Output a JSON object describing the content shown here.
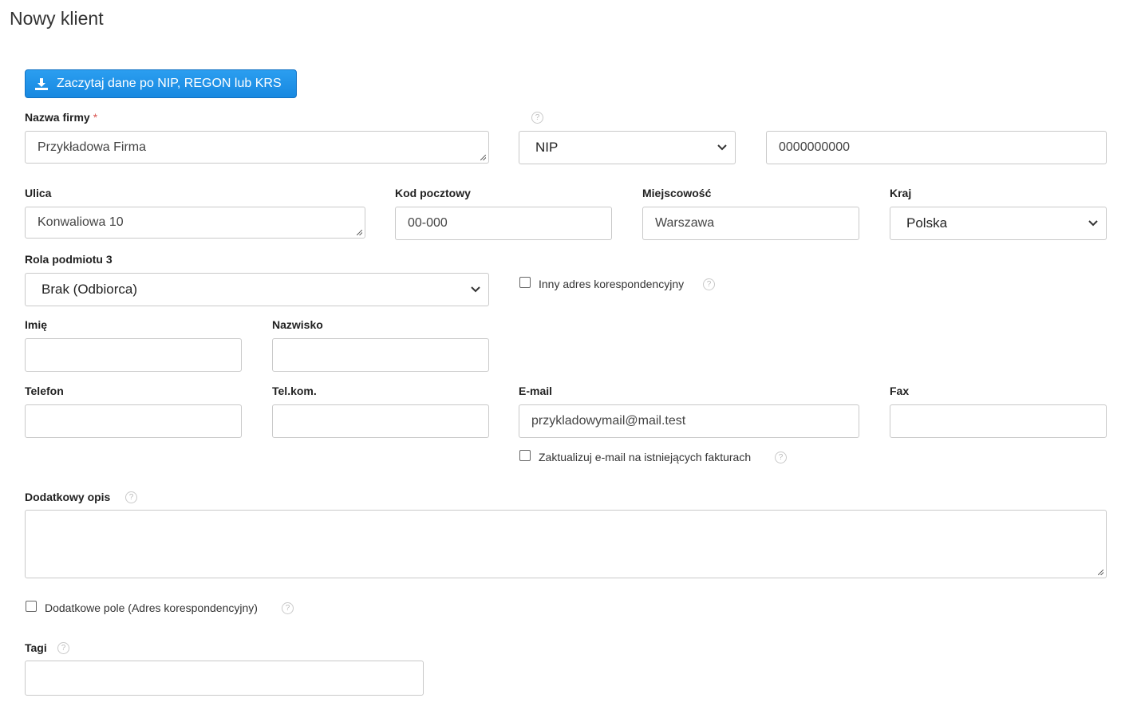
{
  "page": {
    "title": "Nowy klient"
  },
  "toolbar": {
    "fetch_label": "Zaczytaj dane po NIP, REGON lub KRS"
  },
  "company": {
    "name_label": "Nazwa firmy",
    "required_mark": "*",
    "name_value": "Przykładowa Firma",
    "id_type_selected": "NIP",
    "id_value": "0000000000"
  },
  "address": {
    "street_label": "Ulica",
    "street_value": "Konwaliowa 10",
    "postal_label": "Kod pocztowy",
    "postal_value": "00-000",
    "city_label": "Miejscowość",
    "city_value": "Warszawa",
    "country_label": "Kraj",
    "country_selected": "Polska"
  },
  "role": {
    "label": "Rola podmiotu 3",
    "selected": "Brak (Odbiorca)",
    "alt_address_label": "Inny adres korespondencyjny"
  },
  "person": {
    "first_name_label": "Imię",
    "last_name_label": "Nazwisko"
  },
  "contact": {
    "phone_label": "Telefon",
    "mobile_label": "Tel.kom.",
    "email_label": "E-mail",
    "email_value": "przykladowymail@mail.test",
    "fax_label": "Fax",
    "update_email_label": "Zaktualizuj e-mail na istniejących fakturach"
  },
  "description": {
    "label": "Dodatkowy opis"
  },
  "extra": {
    "alt_address_field_label": "Dodatkowe pole (Adres korespondencyjny)"
  },
  "tags": {
    "label": "Tagi"
  },
  "icons": {
    "help": "help-icon",
    "download": "download-icon",
    "dropdown": "chevron-down-icon"
  },
  "colors": {
    "primary_button": "#1788e0",
    "required": "#d9534f",
    "border": "#c9c9c9"
  }
}
